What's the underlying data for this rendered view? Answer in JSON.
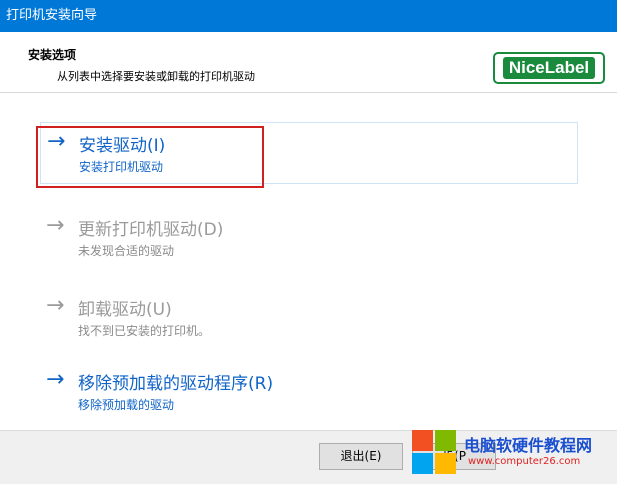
{
  "window": {
    "title": "打印机安装向导"
  },
  "header": {
    "title": "安装选项",
    "subtitle": "从列表中选择要安装或卸载的打印机驱动",
    "logo_text": "NiceLabel"
  },
  "options": [
    {
      "title": "安装驱动(I)",
      "description": "安装打印机驱动",
      "enabled": true,
      "selected": true,
      "icon": "arrow-right-icon"
    },
    {
      "title": "更新打印机驱动(D)",
      "description": "未发现合适的驱动",
      "enabled": false,
      "selected": false,
      "icon": "arrow-right-icon"
    },
    {
      "title": "卸载驱动(U)",
      "description": "找不到已安装的打印机。",
      "enabled": false,
      "selected": false,
      "icon": "arrow-right-icon"
    },
    {
      "title": "移除预加载的驱动程序(R)",
      "description": "移除预加载的驱动",
      "enabled": true,
      "selected": false,
      "icon": "arrow-right-icon"
    }
  ],
  "arrow_glyph": "→",
  "footer": {
    "exit_label": "退出(E)",
    "next_label": "步(P"
  },
  "watermark": {
    "title": "电脑软硬件教程网",
    "url": "www.computer26.com"
  },
  "colors": {
    "titlebar": "#0078d7",
    "link_blue": "#1164c7",
    "disabled_gray": "#9a9a9a",
    "highlight_red": "#d02020",
    "logo_green": "#1a8a3d"
  }
}
